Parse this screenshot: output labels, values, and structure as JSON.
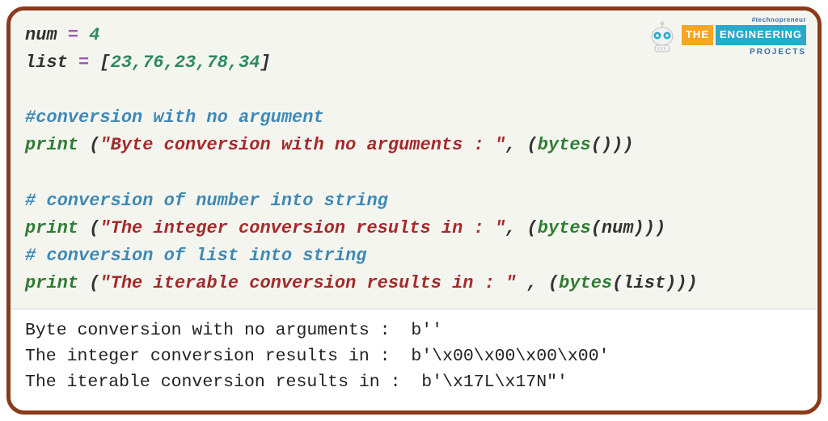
{
  "logo": {
    "tagline": "#technopreneur",
    "the": "THE",
    "engineering": "ENGINEERING",
    "projects": "PROJECTS"
  },
  "code": {
    "l1": {
      "var": "num",
      "op": " = ",
      "num": "4"
    },
    "l2": {
      "var": "list",
      "op": " = ",
      "open": "[",
      "vals": "23,76,23,78,34",
      "close": "]"
    },
    "l4": {
      "comment": "#conversion with no argument"
    },
    "l5": {
      "kw": "print",
      "open": " (",
      "str": "\"Byte conversion with no arguments : \"",
      "mid": ", (",
      "fn": "bytes",
      "args": "()",
      "close": "))"
    },
    "l7": {
      "comment": "# conversion of number into string"
    },
    "l8": {
      "kw": "print",
      "open": " (",
      "str": "\"The integer conversion results in : \"",
      "mid": ", (",
      "fn": "bytes",
      "args": "(num)",
      "close": "))"
    },
    "l9": {
      "comment": "# conversion of list into string"
    },
    "l10": {
      "kw": "print",
      "open": " (",
      "str": "\"The iterable conversion results in : \"",
      "mid": " , (",
      "fn": "bytes",
      "args": "(list)",
      "close": "))"
    }
  },
  "output": {
    "line1": "Byte conversion with no arguments :  b''",
    "line2": "The integer conversion results in :  b'\\x00\\x00\\x00\\x00'",
    "line3": "The iterable conversion results in :  b'\\x17L\\x17N\"'"
  }
}
